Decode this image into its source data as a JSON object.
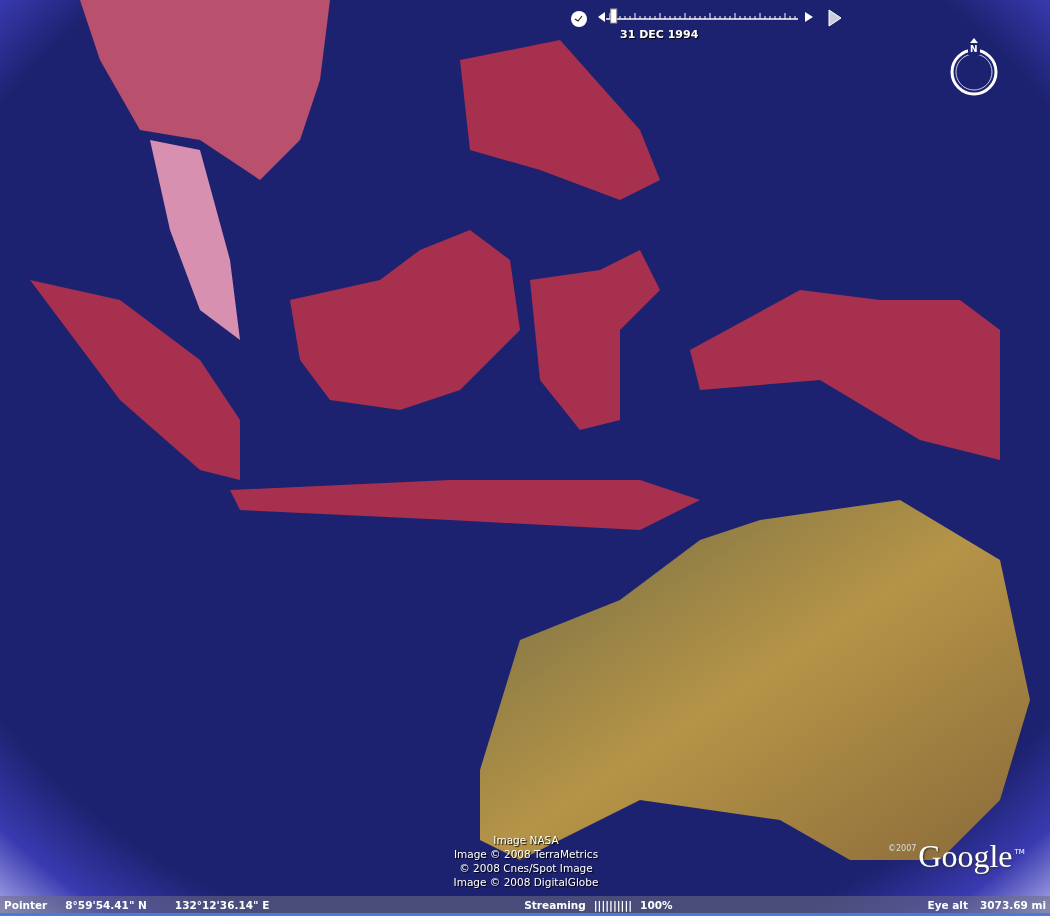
{
  "time_slider": {
    "date": "31 DEC 1994",
    "level": 0.02
  },
  "compass": {
    "label": "N"
  },
  "attribution": [
    "Image NASA",
    "Image © 2008 TerraMetrics",
    "© 2008 Cnes/Spot Image",
    "Image © 2008 DigitalGlobe"
  ],
  "logo": {
    "copyright": "©2007",
    "wordmark": "Google",
    "trademark": "TM"
  },
  "status_bar": {
    "pointer_label": "Pointer",
    "latitude": "8°59'54.41\" N",
    "longitude": "132°12'36.14\" E",
    "streaming_label": "Streaming",
    "streaming_bars": "||||||||||",
    "streaming_percent": "100%",
    "eye_alt_label": "Eye alt",
    "eye_alt": "3073.69 mi"
  }
}
